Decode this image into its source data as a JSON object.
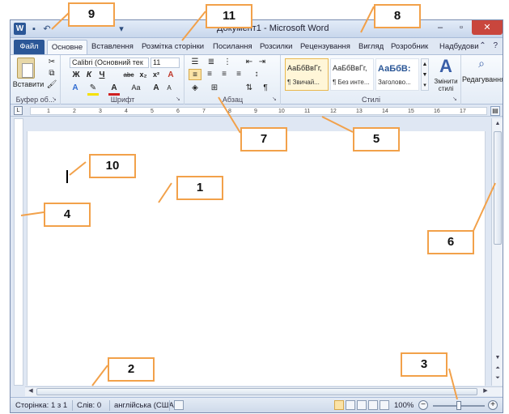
{
  "window": {
    "title": "Документ1 - Microsoft Word",
    "app_icon_letter": "W",
    "qat_icons": [
      "save-icon",
      "undo-icon",
      "customize-icon"
    ],
    "controls": [
      "minimize-icon",
      "maximize-icon",
      "close-icon"
    ]
  },
  "tabs": {
    "file": "Файл",
    "items": [
      "Основне",
      "Вставлення",
      "Розмітка сторінки",
      "Посилання",
      "Розсилки",
      "Рецензування",
      "Вигляд",
      "Розробник",
      "Надбудови"
    ],
    "active": "Основне",
    "right_icons": [
      "collapse-ribbon-icon",
      "help-icon"
    ]
  },
  "ribbon": {
    "clipboard": {
      "label": "Буфер об...",
      "paste_label": "Вставити",
      "cut_icon": "✂",
      "copy_icon": "⧉",
      "format_painter_icon": "🖌"
    },
    "font": {
      "label": "Шрифт",
      "font_name": "Calibri (Основний тек",
      "font_size": "11",
      "bold": "Ж",
      "italic": "К",
      "underline": "Ч",
      "strike": "abc",
      "subscript": "x₂",
      "superscript": "x²",
      "clear": "A",
      "grow": "A",
      "shrink": "A",
      "case": "Aa"
    },
    "paragraph": {
      "label": "Абзац"
    },
    "styles": {
      "label": "Стилі",
      "items": [
        {
          "sample": "АаБбВвГг,",
          "name": "¶ Звичай..."
        },
        {
          "sample": "АаБбВвГг,",
          "name": "¶ Без инте..."
        },
        {
          "sample": "АаБбВ:",
          "name": "Заголово..."
        }
      ],
      "change_label": "Змінити стилі",
      "editing_label": "Редагування"
    }
  },
  "ruler": {
    "numbers": [
      "1",
      "2",
      "3",
      "4",
      "5",
      "6",
      "7",
      "8",
      "9",
      "10",
      "11",
      "12",
      "13",
      "14",
      "15",
      "16",
      "17"
    ]
  },
  "statusbar": {
    "page": "Сторінка: 1 з 1",
    "words": "Слів: 0",
    "language": "англійська (США)",
    "zoom": "100%",
    "zoom_fraction": 0.5
  },
  "callouts": [
    "9",
    "11",
    "8",
    "7",
    "5",
    "10",
    "1",
    "4",
    "6",
    "2",
    "3"
  ]
}
